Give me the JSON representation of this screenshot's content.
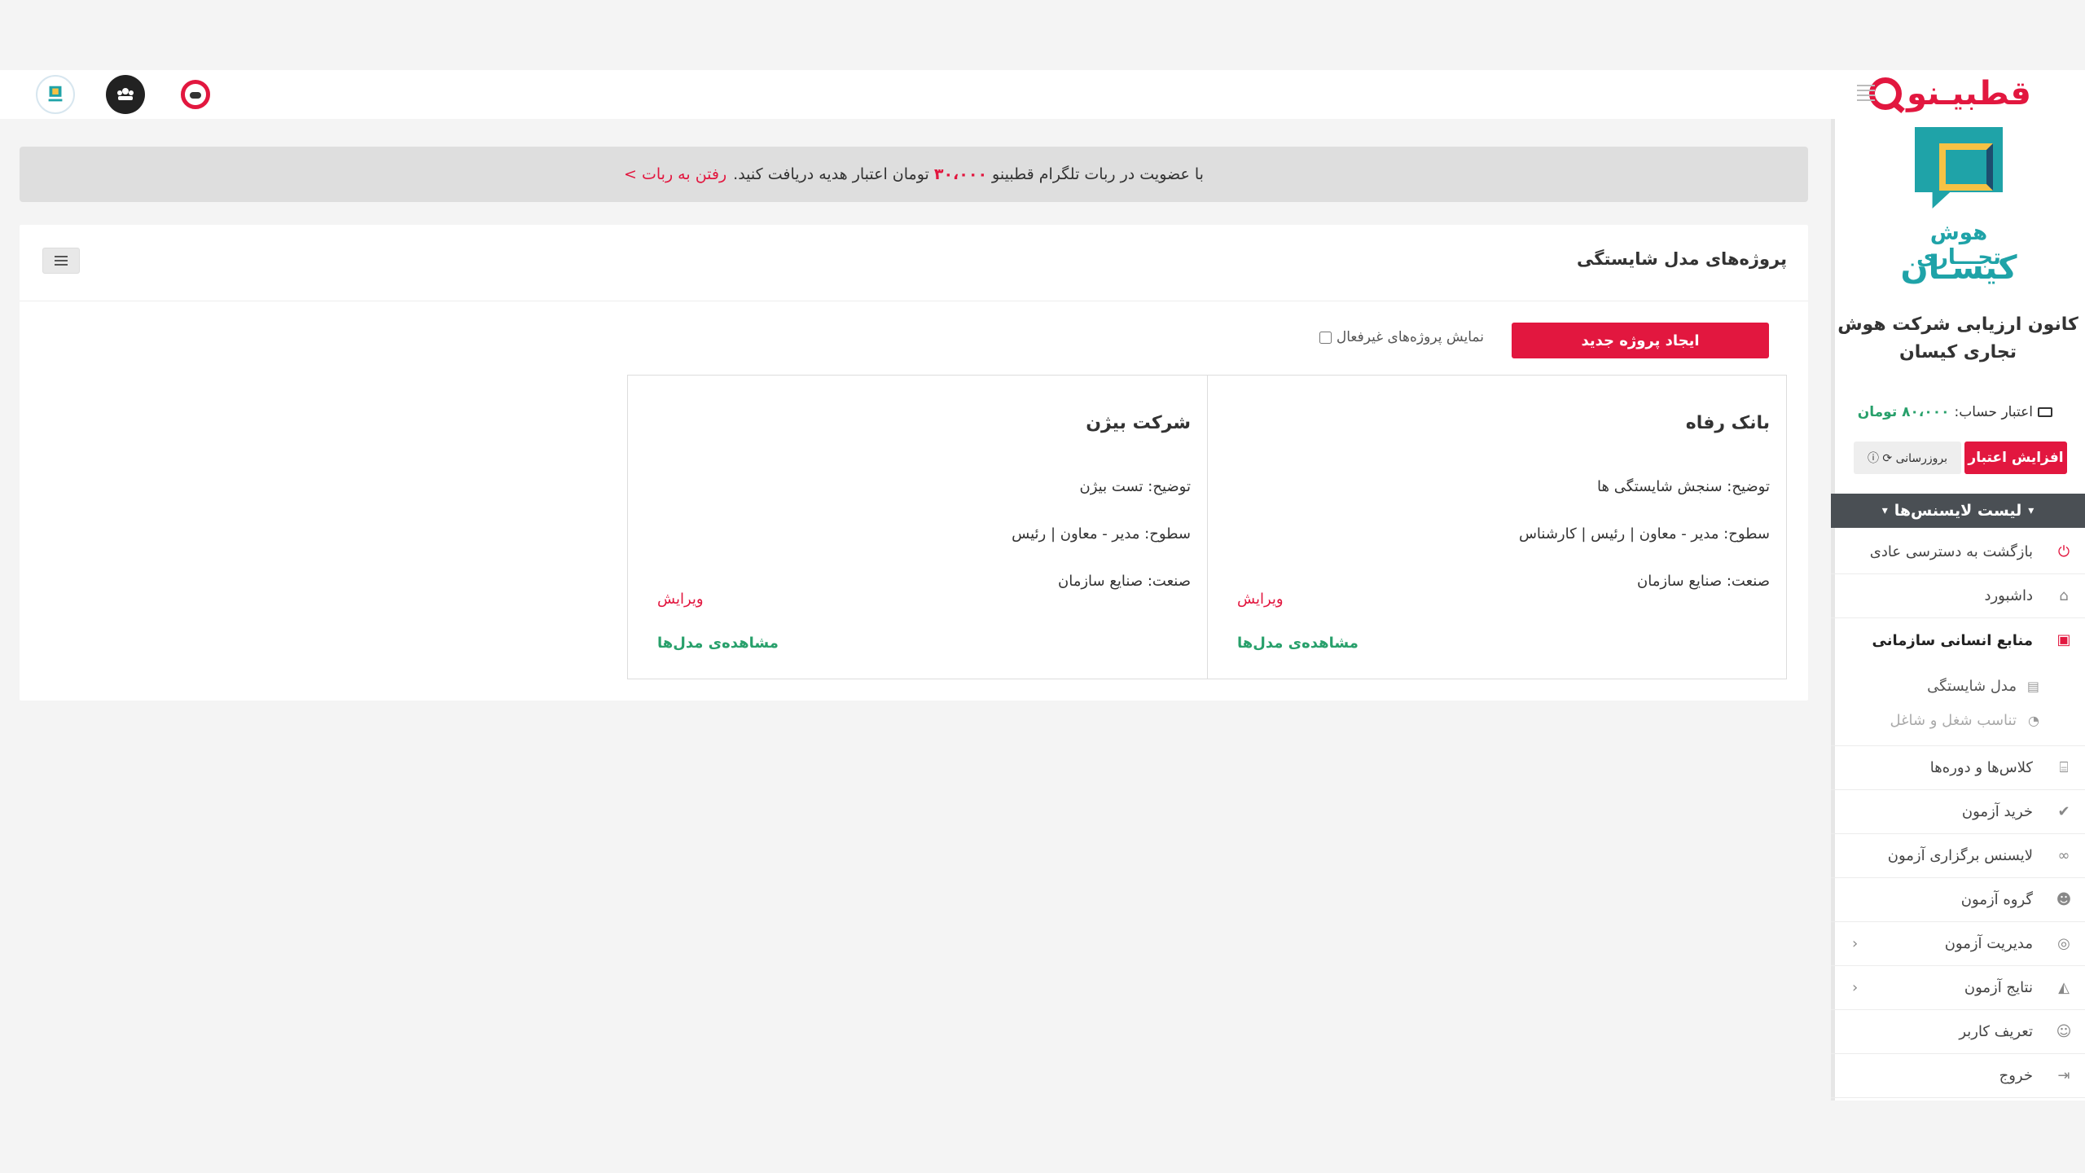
{
  "brand": {
    "name": "قطبیـنو"
  },
  "notice": {
    "text_before": "با عضویت در ربات تلگرام قطبینو",
    "amount": "۳۰،۰۰۰",
    "text_after": "تومان اعتبار هدیه دریافت کنید.",
    "link": "رفتن به ربات >"
  },
  "panel": {
    "title": "پروژه‌های مدل شایستگی",
    "new_project_label": "ایجاد پروژه جدید",
    "show_inactive_label": "نمایش پروژه‌های غیرفعال"
  },
  "cards": [
    {
      "title": "بانک رفاه",
      "description": "توضیح: سنجش شایستگی ها",
      "levels": "سطوح: مدیر - معاون | رئیس | کارشناس",
      "industry": "صنعت: صنایع سازمان",
      "edit_label": "ویرایش",
      "view_label": "مشاهده‌ی مدل‌ها"
    },
    {
      "title": "شرکت بیژن",
      "description": "توضیح: تست بیژن",
      "levels": "سطوح: مدیر - معاون | رئیس",
      "industry": "صنعت: صنایع سازمان",
      "edit_label": "ویرایش",
      "view_label": "مشاهده‌ی مدل‌ها"
    }
  ],
  "sidebar": {
    "logo_line1": "هوش تجـــاری",
    "logo_line2": "کیسـان",
    "org_name": "کانون ارزیابی شرکت هوش تجاری کیسان",
    "credit_label": "اعتبار حساب:",
    "credit_value": "۸۰،۰۰۰ تومان",
    "increase_label": "افزایش اعتبار",
    "refresh_label": "بروزرسانی",
    "license_list_label": "لیست لایسنس‌ها",
    "nav": [
      {
        "label": "بازگشت به دسترسی عادی",
        "icon": "power-icon"
      },
      {
        "label": "داشبورد",
        "icon": "home-icon"
      },
      {
        "label": "منابع انسانی سازمانی",
        "icon": "briefcase-icon"
      },
      {
        "label": "مدل شایستگی",
        "icon": "map-icon"
      },
      {
        "label": "تناسب شغل و شاغل",
        "icon": "gauge-icon"
      },
      {
        "label": "کلاس‌ها و دوره‌ها",
        "icon": "institution-icon"
      },
      {
        "label": "خرید آزمون",
        "icon": "check-circle-icon"
      },
      {
        "label": "لایسنس برگزاری آزمون",
        "icon": "link-icon"
      },
      {
        "label": "گروه آزمون",
        "icon": "users-icon"
      },
      {
        "label": "مدیریت آزمون",
        "icon": "settings-circle-icon"
      },
      {
        "label": "نتایج آزمون",
        "icon": "area-chart-icon"
      },
      {
        "label": "تعریف کاربر",
        "icon": "user-plus-icon"
      },
      {
        "label": "خروج",
        "icon": "sign-out-icon"
      }
    ]
  },
  "colors": {
    "accent": "#e2173f",
    "green": "#28a06b",
    "teal": "#1fa3a8"
  }
}
